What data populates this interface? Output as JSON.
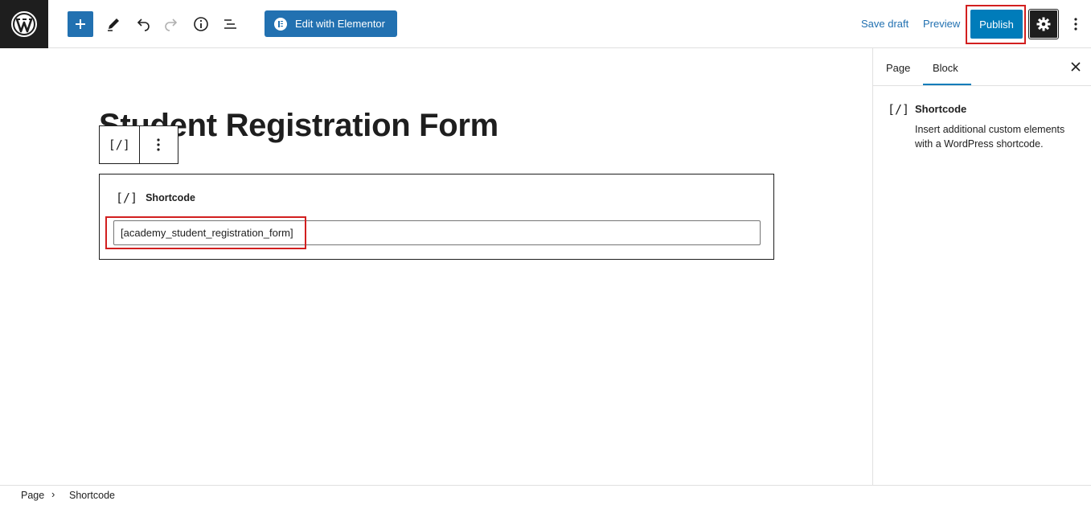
{
  "toolbar": {
    "logo_icon": "wordpress-logo-icon",
    "add_block_icon": "plus-icon",
    "tools_icon": "pencil-icon",
    "undo_icon": "undo-icon",
    "redo_icon": "redo-icon",
    "details_icon": "info-icon",
    "list_view_icon": "list-view-icon",
    "elementor_label": "Edit with Elementor",
    "save_draft_label": "Save draft",
    "preview_label": "Preview",
    "publish_label": "Publish",
    "settings_icon": "gear-icon",
    "options_icon": "more-vertical-icon"
  },
  "editor": {
    "page_title": "Student Registration Form",
    "block_toolbar": {
      "block_icon_text": "[/]",
      "options_icon": "more-vertical-icon"
    },
    "shortcode_block": {
      "icon_text": "[/]",
      "label": "Shortcode",
      "value": "[academy_student_registration_form]"
    }
  },
  "sidebar": {
    "tabs": [
      {
        "label": "Page",
        "active": false
      },
      {
        "label": "Block",
        "active": true
      }
    ],
    "close_icon": "close-icon",
    "block_card": {
      "icon_text": "[/]",
      "title": "Shortcode",
      "description": "Insert additional custom elements with a WordPress shortcode."
    }
  },
  "breadcrumb": {
    "items": [
      "Page",
      "Shortcode"
    ],
    "separator": "›"
  },
  "colors": {
    "accent": "#2271b1",
    "publish": "#007cba",
    "dark": "#1e1e1e",
    "highlight": "#d21f1f"
  }
}
